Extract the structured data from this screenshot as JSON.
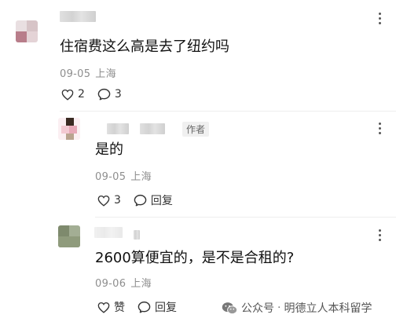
{
  "comments": [
    {
      "text": "住宿费这么高是去了纽约吗",
      "date": "09-05",
      "location": "上海",
      "likes": "2",
      "replies": "3"
    },
    {
      "author_tag": "作者",
      "text": "是的",
      "date": "09-05",
      "location": "上海",
      "likes": "3",
      "reply_label": "回复"
    },
    {
      "text": "2600算便宜的，是不是合租的?",
      "date": "09-06",
      "location": "上海",
      "like_label": "赞",
      "reply_label": "回复"
    }
  ],
  "watermark": {
    "account_label": "公众号",
    "separator": "·",
    "account_name": "明德立人本科留学"
  },
  "icons": {
    "heart": "heart-icon",
    "comment": "comment-bubble-icon",
    "more": "more-vertical-icon",
    "wechat": "wechat-logo-icon"
  }
}
